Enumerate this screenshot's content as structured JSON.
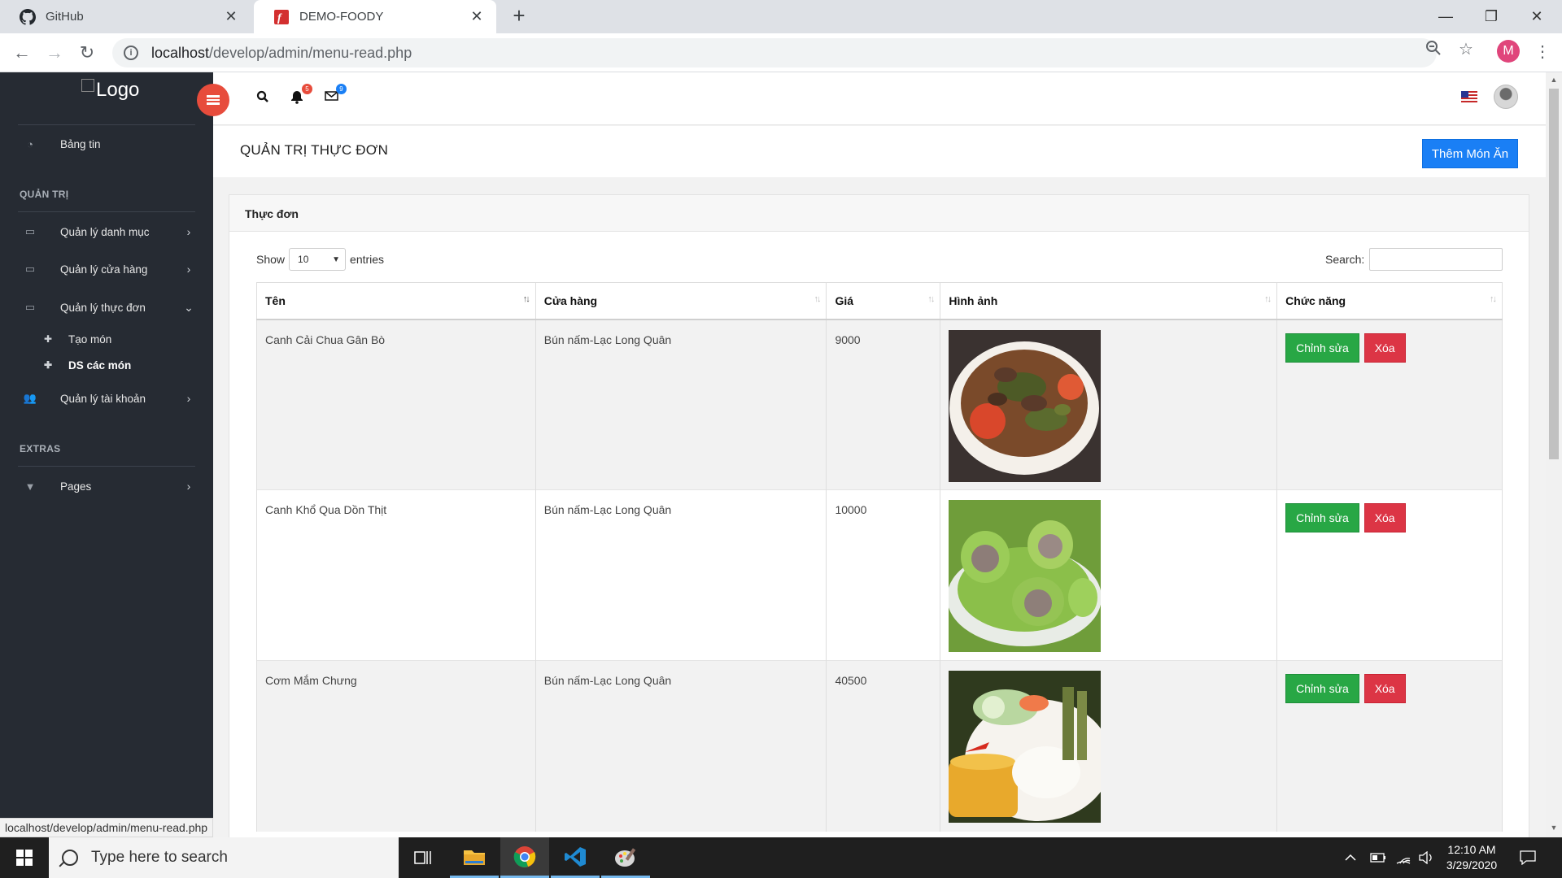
{
  "browser": {
    "tabs": [
      {
        "title": "GitHub",
        "icon": "github-icon"
      },
      {
        "title": "DEMO-FOODY",
        "icon": "foody-favicon"
      }
    ],
    "url_host": "localhost",
    "url_path": "/develop/admin/menu-read.php",
    "profile_initial": "M",
    "status_url": "localhost/develop/admin/menu-read.php"
  },
  "sidebar": {
    "logo_alt": "Logo",
    "dashboard": "Bảng tin",
    "section_admin": "QUẢN TRỊ",
    "items": [
      {
        "label": "Quản lý danh mục",
        "icon": "laptop-icon"
      },
      {
        "label": "Quản lý cửa hàng",
        "icon": "laptop-icon"
      },
      {
        "label": "Quản lý thực đơn",
        "icon": "laptop-icon"
      }
    ],
    "sub_items": [
      {
        "label": "Tạo món",
        "icon": "puzzle-icon"
      },
      {
        "label": "DS các món",
        "icon": "puzzle-icon"
      }
    ],
    "accounts": "Quản lý tài khoản",
    "section_extras": "EXTRAS",
    "pages": "Pages"
  },
  "topbar": {
    "notifications_count": "5",
    "messages_count": "9"
  },
  "page": {
    "title": "QUẢN TRỊ THỰC ĐƠN",
    "add_button": "Thêm Món Ăn",
    "card_title": "Thực đơn"
  },
  "table": {
    "show_label": "Show",
    "entries_value": "10",
    "entries_label": "entries",
    "search_label": "Search:",
    "headers": [
      "Tên",
      "Cửa hàng",
      "Giá",
      "Hình ảnh",
      "Chức năng"
    ],
    "edit_label": "Chỉnh sửa",
    "delete_label": "Xóa",
    "rows": [
      {
        "name": "Canh Cải Chua Gân Bò",
        "store": "Bún nấm-Lạc Long Quân",
        "price": "9000"
      },
      {
        "name": "Canh Khổ Qua Dồn Thịt",
        "store": "Bún nấm-Lạc Long Quân",
        "price": "10000"
      },
      {
        "name": "Cơm Mắm Chưng",
        "store": "Bún nấm-Lạc Long Quân",
        "price": "40500"
      }
    ]
  },
  "taskbar": {
    "search_placeholder": "Type here to search",
    "time": "12:10 AM",
    "date": "3/29/2020"
  },
  "colors": {
    "sidebar_bg": "#262b33",
    "primary": "#1a7ff5",
    "success": "#28a745",
    "danger": "#dc3545",
    "burger": "#e74c3c"
  }
}
